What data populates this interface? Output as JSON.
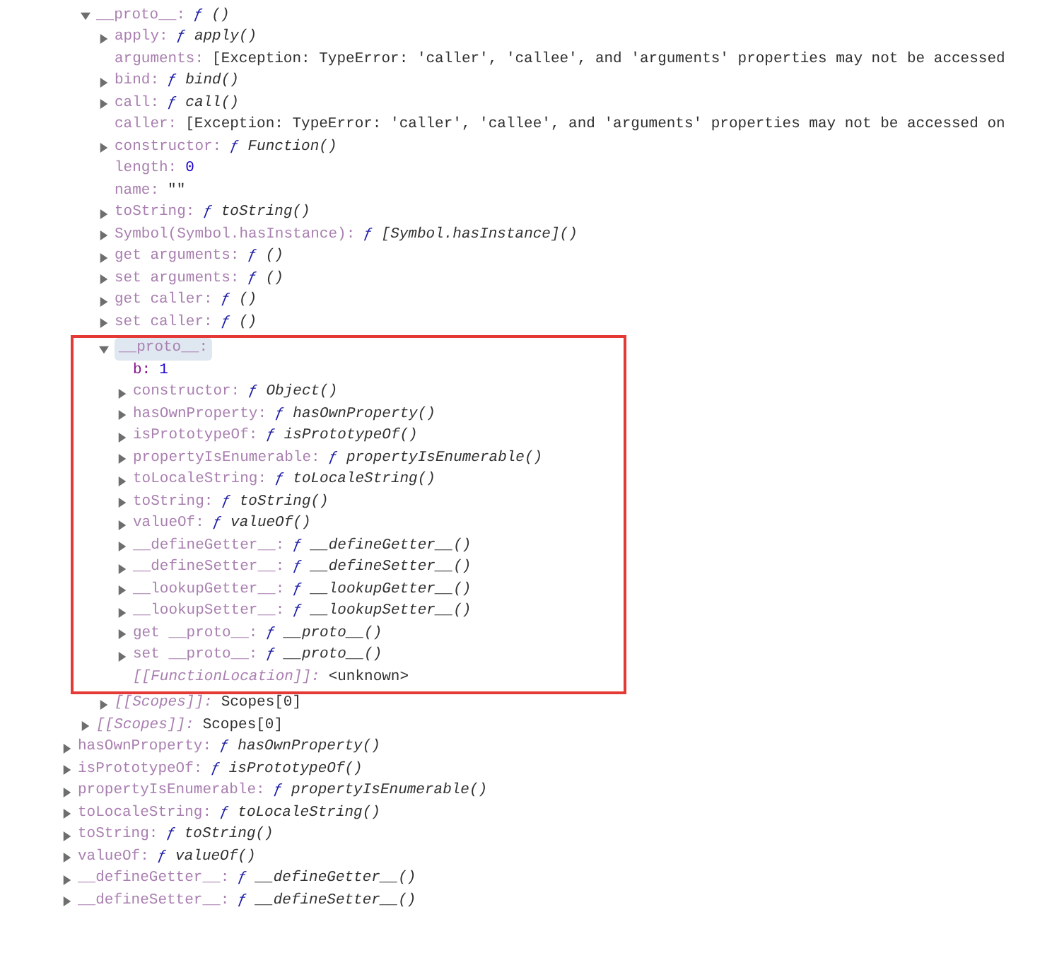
{
  "nested_properties": [
    {
      "key": "__proto__:",
      "kind": "inherited",
      "value": {
        "kind": "function",
        "sign": "ƒ",
        "text": "()"
      },
      "expandable": true,
      "expanded": true,
      "selected": false,
      "children": [
        {
          "key": "apply:",
          "kind": "inherited",
          "value": {
            "kind": "function",
            "sign": "ƒ",
            "text": "apply()"
          },
          "expandable": true,
          "expanded": false,
          "selected": false
        },
        {
          "key": "arguments:",
          "kind": "inherited",
          "value": {
            "kind": "plain",
            "text": "[Exception: TypeError: 'caller', 'callee', and 'arguments' properties may not be accessed"
          },
          "expandable": false,
          "expanded": false,
          "selected": false
        },
        {
          "key": "bind:",
          "kind": "inherited",
          "value": {
            "kind": "function",
            "sign": "ƒ",
            "text": "bind()"
          },
          "expandable": true,
          "expanded": false,
          "selected": false
        },
        {
          "key": "call:",
          "kind": "inherited",
          "value": {
            "kind": "function",
            "sign": "ƒ",
            "text": "call()"
          },
          "expandable": true,
          "expanded": false,
          "selected": false
        },
        {
          "key": "caller:",
          "kind": "inherited",
          "value": {
            "kind": "plain",
            "text": "[Exception: TypeError: 'caller', 'callee', and 'arguments' properties may not be accessed on"
          },
          "expandable": false,
          "expanded": false,
          "selected": false
        },
        {
          "key": "constructor:",
          "kind": "inherited",
          "value": {
            "kind": "function",
            "sign": "ƒ",
            "text": "Function()"
          },
          "expandable": true,
          "expanded": false,
          "selected": false
        },
        {
          "key": "length:",
          "kind": "inherited",
          "value": {
            "kind": "number",
            "text": "0"
          },
          "expandable": false,
          "expanded": false,
          "selected": false
        },
        {
          "key": "name:",
          "kind": "inherited",
          "value": {
            "kind": "string",
            "text": "\"\""
          },
          "expandable": false,
          "expanded": false,
          "selected": false
        },
        {
          "key": "toString:",
          "kind": "inherited",
          "value": {
            "kind": "function",
            "sign": "ƒ",
            "text": "toString()"
          },
          "expandable": true,
          "expanded": false,
          "selected": false
        },
        {
          "key": "Symbol(Symbol.hasInstance):",
          "kind": "inherited",
          "value": {
            "kind": "function",
            "sign": "ƒ",
            "text": "[Symbol.hasInstance]()"
          },
          "expandable": true,
          "expanded": false,
          "selected": false
        },
        {
          "key": "get arguments:",
          "kind": "inherited",
          "value": {
            "kind": "function",
            "sign": "ƒ",
            "text": "()"
          },
          "expandable": true,
          "expanded": false,
          "selected": false
        },
        {
          "key": "set arguments:",
          "kind": "inherited",
          "value": {
            "kind": "function",
            "sign": "ƒ",
            "text": "()"
          },
          "expandable": true,
          "expanded": false,
          "selected": false
        },
        {
          "key": "get caller:",
          "kind": "inherited",
          "value": {
            "kind": "function",
            "sign": "ƒ",
            "text": "()"
          },
          "expandable": true,
          "expanded": false,
          "selected": false
        },
        {
          "key": "set caller:",
          "kind": "inherited",
          "value": {
            "kind": "function",
            "sign": "ƒ",
            "text": "()"
          },
          "expandable": true,
          "expanded": false,
          "selected": false
        },
        {
          "key": "__proto__:",
          "kind": "inherited",
          "expandable": true,
          "expanded": true,
          "selected": true,
          "boxed": true,
          "children": [
            {
              "key": "b:",
              "kind": "own",
              "value": {
                "kind": "number",
                "text": "1"
              },
              "expandable": false,
              "expanded": false,
              "selected": false
            },
            {
              "key": "constructor:",
              "kind": "inherited",
              "value": {
                "kind": "function",
                "sign": "ƒ",
                "text": "Object()"
              },
              "expandable": true,
              "expanded": false,
              "selected": false
            },
            {
              "key": "hasOwnProperty:",
              "kind": "inherited",
              "value": {
                "kind": "function",
                "sign": "ƒ",
                "text": "hasOwnProperty()"
              },
              "expandable": true,
              "expanded": false,
              "selected": false
            },
            {
              "key": "isPrototypeOf:",
              "kind": "inherited",
              "value": {
                "kind": "function",
                "sign": "ƒ",
                "text": "isPrototypeOf()"
              },
              "expandable": true,
              "expanded": false,
              "selected": false
            },
            {
              "key": "propertyIsEnumerable:",
              "kind": "inherited",
              "value": {
                "kind": "function",
                "sign": "ƒ",
                "text": "propertyIsEnumerable()"
              },
              "expandable": true,
              "expanded": false,
              "selected": false
            },
            {
              "key": "toLocaleString:",
              "kind": "inherited",
              "value": {
                "kind": "function",
                "sign": "ƒ",
                "text": "toLocaleString()"
              },
              "expandable": true,
              "expanded": false,
              "selected": false
            },
            {
              "key": "toString:",
              "kind": "inherited",
              "value": {
                "kind": "function",
                "sign": "ƒ",
                "text": "toString()"
              },
              "expandable": true,
              "expanded": false,
              "selected": false
            },
            {
              "key": "valueOf:",
              "kind": "inherited",
              "value": {
                "kind": "function",
                "sign": "ƒ",
                "text": "valueOf()"
              },
              "expandable": true,
              "expanded": false,
              "selected": false
            },
            {
              "key": "__defineGetter__:",
              "kind": "inherited",
              "value": {
                "kind": "function",
                "sign": "ƒ",
                "text": "__defineGetter__()"
              },
              "expandable": true,
              "expanded": false,
              "selected": false
            },
            {
              "key": "__defineSetter__:",
              "kind": "inherited",
              "value": {
                "kind": "function",
                "sign": "ƒ",
                "text": "__defineSetter__()"
              },
              "expandable": true,
              "expanded": false,
              "selected": false
            },
            {
              "key": "__lookupGetter__:",
              "kind": "inherited",
              "value": {
                "kind": "function",
                "sign": "ƒ",
                "text": "__lookupGetter__()"
              },
              "expandable": true,
              "expanded": false,
              "selected": false
            },
            {
              "key": "__lookupSetter__:",
              "kind": "inherited",
              "value": {
                "kind": "function",
                "sign": "ƒ",
                "text": "__lookupSetter__()"
              },
              "expandable": true,
              "expanded": false,
              "selected": false
            },
            {
              "key": "get __proto__:",
              "kind": "inherited",
              "value": {
                "kind": "function",
                "sign": "ƒ",
                "text": "__proto__()"
              },
              "expandable": true,
              "expanded": false,
              "selected": false
            },
            {
              "key": "set __proto__:",
              "kind": "inherited",
              "value": {
                "kind": "function",
                "sign": "ƒ",
                "text": "__proto__()"
              },
              "expandable": true,
              "expanded": false,
              "selected": false
            },
            {
              "key": "[[FunctionLocation]]:",
              "kind": "internal",
              "value": {
                "kind": "plain",
                "text": "<unknown>"
              },
              "expandable": false,
              "expanded": false,
              "selected": false
            }
          ]
        },
        {
          "key": "[[Scopes]]:",
          "kind": "internal",
          "value": {
            "kind": "plain",
            "text": "Scopes[0]"
          },
          "expandable": true,
          "expanded": false,
          "selected": false
        }
      ]
    },
    {
      "key": "[[Scopes]]:",
      "kind": "internal",
      "value": {
        "kind": "plain",
        "text": "Scopes[0]"
      },
      "expandable": true,
      "expanded": false,
      "selected": false
    }
  ],
  "properties": [
    {
      "key": "hasOwnProperty:",
      "kind": "inherited",
      "value": {
        "kind": "function",
        "sign": "ƒ",
        "text": "hasOwnProperty()"
      },
      "expandable": true,
      "expanded": false,
      "selected": false
    },
    {
      "key": "isPrototypeOf:",
      "kind": "inherited",
      "value": {
        "kind": "function",
        "sign": "ƒ",
        "text": "isPrototypeOf()"
      },
      "expandable": true,
      "expanded": false,
      "selected": false
    },
    {
      "key": "propertyIsEnumerable:",
      "kind": "inherited",
      "value": {
        "kind": "function",
        "sign": "ƒ",
        "text": "propertyIsEnumerable()"
      },
      "expandable": true,
      "expanded": false,
      "selected": false
    },
    {
      "key": "toLocaleString:",
      "kind": "inherited",
      "value": {
        "kind": "function",
        "sign": "ƒ",
        "text": "toLocaleString()"
      },
      "expandable": true,
      "expanded": false,
      "selected": false
    },
    {
      "key": "toString:",
      "kind": "inherited",
      "value": {
        "kind": "function",
        "sign": "ƒ",
        "text": "toString()"
      },
      "expandable": true,
      "expanded": false,
      "selected": false
    },
    {
      "key": "valueOf:",
      "kind": "inherited",
      "value": {
        "kind": "function",
        "sign": "ƒ",
        "text": "valueOf()"
      },
      "expandable": true,
      "expanded": false,
      "selected": false
    },
    {
      "key": "__defineGetter__:",
      "kind": "inherited",
      "value": {
        "kind": "function",
        "sign": "ƒ",
        "text": "__defineGetter__()"
      },
      "expandable": true,
      "expanded": false,
      "selected": false
    },
    {
      "key": "__defineSetter__:",
      "kind": "inherited",
      "value": {
        "kind": "function",
        "sign": "ƒ",
        "text": "__defineSetter__()"
      },
      "expandable": true,
      "expanded": false,
      "selected": false
    }
  ]
}
